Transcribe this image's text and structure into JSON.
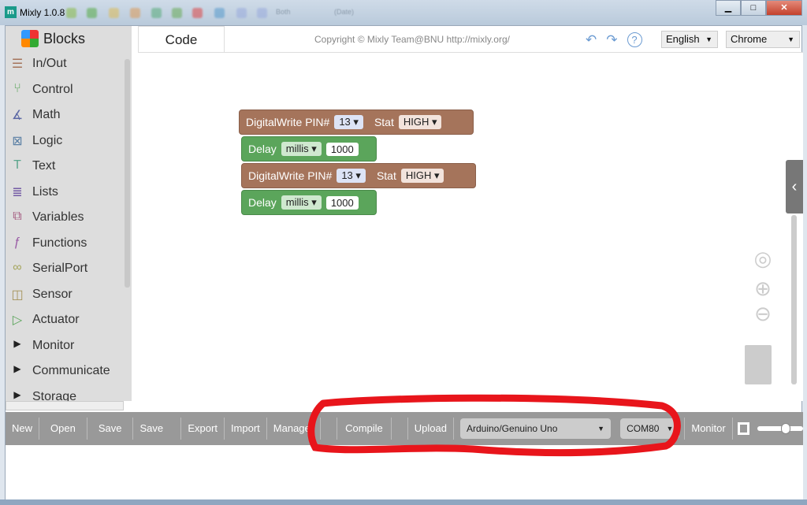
{
  "window": {
    "title": "Mixly 1.0.8",
    "toolbar_blur": [
      "Both",
      "(Date)"
    ],
    "buttons": [
      "minimize",
      "maximize",
      "close"
    ]
  },
  "sidebar": {
    "header": "Blocks",
    "items": [
      {
        "label": "In/Out",
        "icon": "inout-icon",
        "color": "#a5745b"
      },
      {
        "label": "Control",
        "icon": "control-icon",
        "color": "#5ba55b"
      },
      {
        "label": "Math",
        "icon": "math-icon",
        "color": "#5b67a5"
      },
      {
        "label": "Logic",
        "icon": "logic-icon",
        "color": "#5b80a5"
      },
      {
        "label": "Text",
        "icon": "text-icon",
        "color": "#5ba58c"
      },
      {
        "label": "Lists",
        "icon": "lists-icon",
        "color": "#745ba5"
      },
      {
        "label": "Variables",
        "icon": "variables-icon",
        "color": "#a55b80"
      },
      {
        "label": "Functions",
        "icon": "functions-icon",
        "color": "#995ba5"
      },
      {
        "label": "SerialPort",
        "icon": "serialport-icon",
        "color": "#a5a55b"
      },
      {
        "label": "Sensor",
        "icon": "sensor-icon",
        "color": "#a5935b"
      },
      {
        "label": "Actuator",
        "icon": "actuator-icon",
        "color": "#5ba55b"
      },
      {
        "label": "Monitor",
        "icon": "triangle-right-icon",
        "color": "#222"
      },
      {
        "label": "Communicate",
        "icon": "triangle-right-icon",
        "color": "#222"
      },
      {
        "label": "Storage",
        "icon": "triangle-right-icon",
        "color": "#222"
      }
    ]
  },
  "header": {
    "tab": "Code",
    "copyright": "Copyright © Mixly Team@BNU http://mixly.org/",
    "language": "English",
    "browser": "Chrome"
  },
  "blocks": [
    {
      "type": "digitalwrite",
      "label": "DigitalWrite PIN#",
      "pin": "13",
      "stat_label": "Stat",
      "stat": "HIGH"
    },
    {
      "type": "delay",
      "label": "Delay",
      "unit": "millis",
      "value": "1000"
    },
    {
      "type": "digitalwrite",
      "label": "DigitalWrite PIN#",
      "pin": "13",
      "stat_label": "Stat",
      "stat": "HIGH"
    },
    {
      "type": "delay",
      "label": "Delay",
      "unit": "millis",
      "value": "1000"
    }
  ],
  "toolbar": {
    "new": "New",
    "open": "Open",
    "save": "Save",
    "save_as": "Save as",
    "export": "Export",
    "import": "Import",
    "manager": "Manager",
    "compile": "Compile",
    "upload": "Upload",
    "board": "Arduino/Genuino Uno",
    "port": "COM80",
    "monitor": "Monitor"
  },
  "annotation_color": "#e8151b"
}
